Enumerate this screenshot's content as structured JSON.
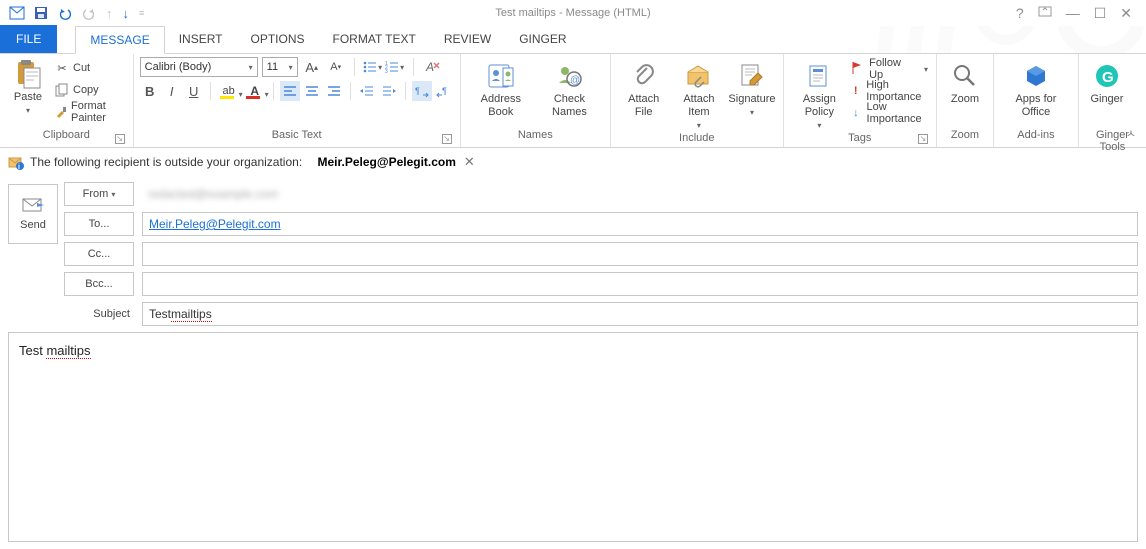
{
  "window": {
    "title": "Test mailtips - Message (HTML)"
  },
  "tabs": {
    "file": "FILE",
    "message": "MESSAGE",
    "insert": "INSERT",
    "options": "OPTIONS",
    "format_text": "FORMAT TEXT",
    "review": "REVIEW",
    "ginger": "GINGER"
  },
  "ribbon": {
    "clipboard": {
      "label": "Clipboard",
      "paste": "Paste",
      "cut": "Cut",
      "copy": "Copy",
      "format_painter": "Format Painter"
    },
    "basic_text": {
      "label": "Basic Text",
      "font_name": "Calibri (Body)",
      "font_size": "11"
    },
    "names": {
      "label": "Names",
      "address_book": "Address Book",
      "check_names": "Check Names"
    },
    "include": {
      "label": "Include",
      "attach_file": "Attach File",
      "attach_item": "Attach Item",
      "signature": "Signature"
    },
    "tags": {
      "label": "Tags",
      "assign_policy": "Assign Policy",
      "follow_up": "Follow Up",
      "high": "High Importance",
      "low": "Low Importance"
    },
    "zoom": {
      "label": "Zoom",
      "zoom": "Zoom"
    },
    "addins": {
      "label": "Add-ins",
      "apps": "Apps for Office"
    },
    "gingertools": {
      "label": "Ginger Tools",
      "ginger": "Ginger"
    }
  },
  "mailtip": {
    "prefix": "The following recipient is outside your organization:",
    "address": "Meir.Peleg@Pelegit.com"
  },
  "compose": {
    "send": "Send",
    "from": "From",
    "to": "To...",
    "cc": "Cc...",
    "bcc": "Bcc...",
    "subject_label": "Subject",
    "to_value": "Meir.Peleg@Pelegit.com",
    "subject_value_pre": "Test ",
    "subject_value_err": "mailtips",
    "body_pre": "Test ",
    "body_err": "mailtips"
  }
}
